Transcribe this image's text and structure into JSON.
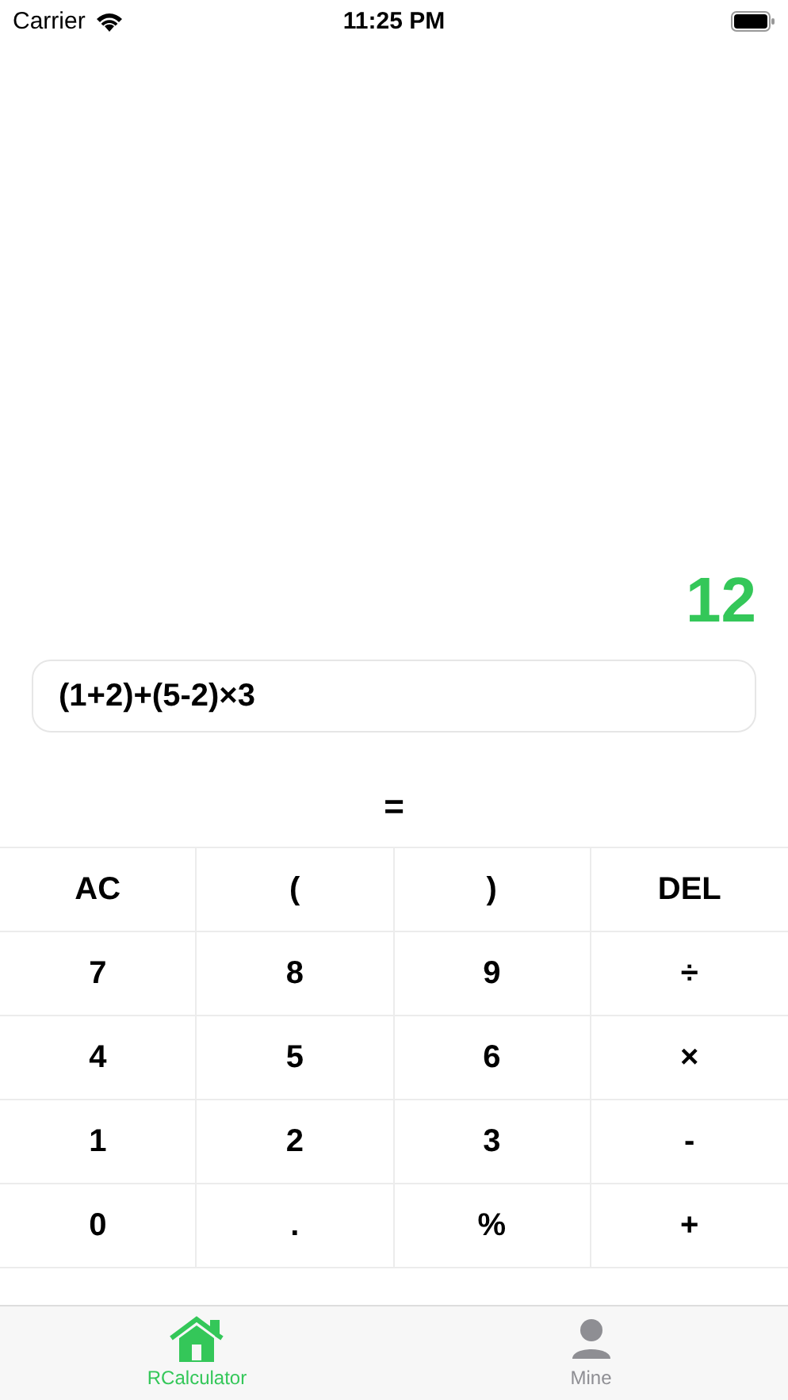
{
  "status_bar": {
    "carrier": "Carrier",
    "time": "11:25 PM"
  },
  "result": "12",
  "expression": {
    "value": "(1+2)+(5-2)×3"
  },
  "equals": "=",
  "keypad": [
    [
      "AC",
      "(",
      ")",
      "DEL"
    ],
    [
      "7",
      "8",
      "9",
      "÷"
    ],
    [
      "4",
      "5",
      "6",
      "×"
    ],
    [
      "1",
      "2",
      "3",
      "-"
    ],
    [
      "0",
      ".",
      "%",
      "+"
    ]
  ],
  "tabs": [
    {
      "label": "RCalculator",
      "kind": "home",
      "selected": true
    },
    {
      "label": "Mine",
      "kind": "person",
      "selected": false
    }
  ]
}
